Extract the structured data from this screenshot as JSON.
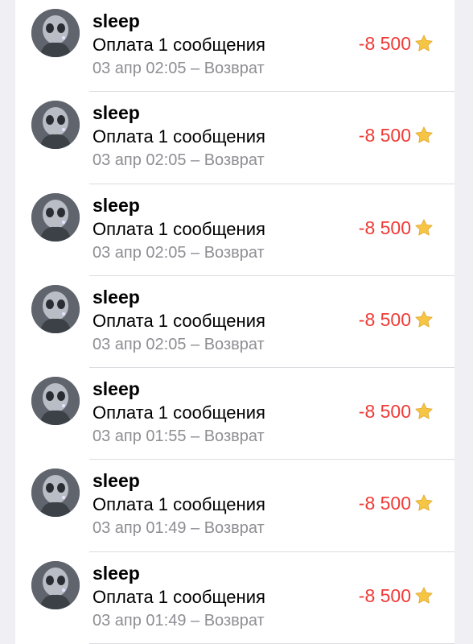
{
  "colors": {
    "amount": "#ef3b36",
    "meta": "#8e8e93",
    "background": "#efeff4",
    "star": "#f6c544"
  },
  "transactions": [
    {
      "name": "sleep",
      "description": "Оплата 1 сообщения",
      "meta": "03 апр 02:05 – Возврат",
      "amount": "-8 500",
      "icon": "star-icon"
    },
    {
      "name": "sleep",
      "description": "Оплата 1 сообщения",
      "meta": "03 апр 02:05 – Возврат",
      "amount": "-8 500",
      "icon": "star-icon"
    },
    {
      "name": "sleep",
      "description": "Оплата 1 сообщения",
      "meta": "03 апр 02:05 – Возврат",
      "amount": "-8 500",
      "icon": "star-icon"
    },
    {
      "name": "sleep",
      "description": "Оплата 1 сообщения",
      "meta": "03 апр 02:05 – Возврат",
      "amount": "-8 500",
      "icon": "star-icon"
    },
    {
      "name": "sleep",
      "description": "Оплата 1 сообщения",
      "meta": "03 апр 01:55 – Возврат",
      "amount": "-8 500",
      "icon": "star-icon"
    },
    {
      "name": "sleep",
      "description": "Оплата 1 сообщения",
      "meta": "03 апр 01:49 – Возврат",
      "amount": "-8 500",
      "icon": "star-icon"
    },
    {
      "name": "sleep",
      "description": "Оплата 1 сообщения",
      "meta": "03 апр 01:49 – Возврат",
      "amount": "-8 500",
      "icon": "star-icon"
    }
  ]
}
